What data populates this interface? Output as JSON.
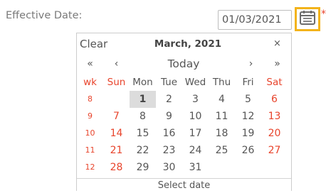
{
  "field": {
    "label": "Effective Date:",
    "value": "01/03/2021",
    "required_marker": "*"
  },
  "calendar_button": {
    "icon": "calendar-icon",
    "accent_color": "#f3b31a"
  },
  "datepicker": {
    "clear_label": "Clear",
    "month_title": "March, 2021",
    "close_label": "×",
    "prev_year_label": "«",
    "prev_month_label": "‹",
    "today_label": "Today",
    "next_month_label": "›",
    "next_year_label": "»",
    "weekday_header": [
      "wk",
      "Sun",
      "Mon",
      "Tue",
      "Wed",
      "Thu",
      "Fri",
      "Sat"
    ],
    "weeks": [
      {
        "wk": "8",
        "days": [
          "",
          "1",
          "2",
          "3",
          "4",
          "5",
          "6"
        ]
      },
      {
        "wk": "9",
        "days": [
          "7",
          "8",
          "9",
          "10",
          "11",
          "12",
          "13"
        ]
      },
      {
        "wk": "10",
        "days": [
          "14",
          "15",
          "16",
          "17",
          "18",
          "19",
          "20"
        ]
      },
      {
        "wk": "11",
        "days": [
          "21",
          "22",
          "23",
          "24",
          "25",
          "26",
          "27"
        ]
      },
      {
        "wk": "12",
        "days": [
          "28",
          "29",
          "30",
          "31",
          "",
          "",
          ""
        ]
      }
    ],
    "selected_day": "1",
    "footer_label": "Select date",
    "weekend_color": "#e8442c"
  }
}
